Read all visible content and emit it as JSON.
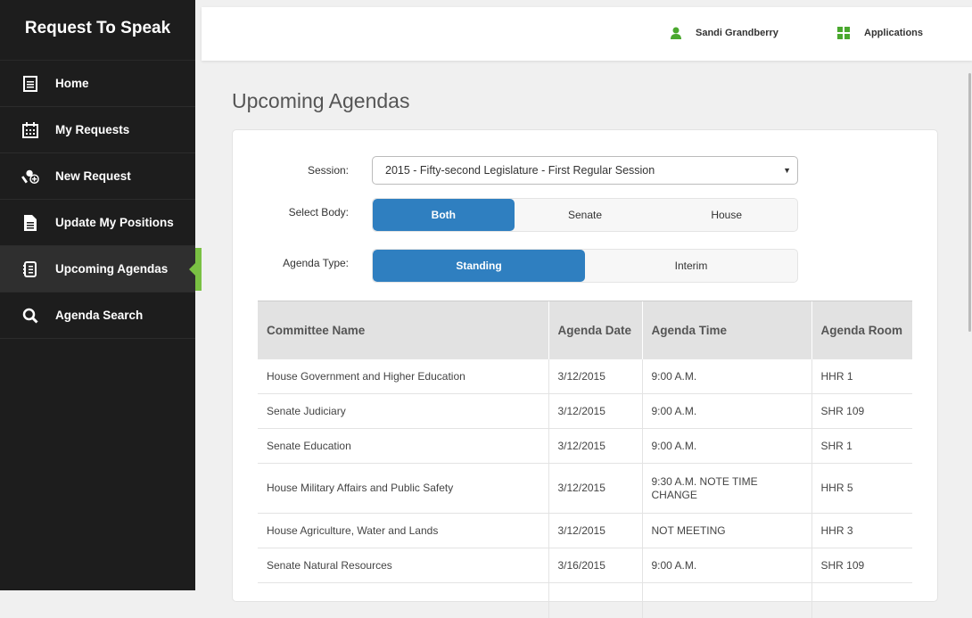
{
  "app": {
    "title": "Request To Speak"
  },
  "sidebar": {
    "items": [
      {
        "label": "Home",
        "icon": "home-list-icon"
      },
      {
        "label": "My Requests",
        "icon": "calendar-icon"
      },
      {
        "label": "New Request",
        "icon": "new-request-microphone-icon"
      },
      {
        "label": "Update My Positions",
        "icon": "document-icon"
      },
      {
        "label": "Upcoming Agendas",
        "icon": "agenda-icon"
      },
      {
        "label": "Agenda Search",
        "icon": "search-icon"
      }
    ],
    "active_index": 4
  },
  "header": {
    "user_name": "Sandi Grandberry",
    "apps_label": "Applications"
  },
  "page": {
    "title": "Upcoming Agendas"
  },
  "form": {
    "session_label": "Session:",
    "session_value": "2015 - Fifty-second Legislature - First Regular Session",
    "body_label": "Select Body:",
    "body_options": [
      "Both",
      "Senate",
      "House"
    ],
    "body_selected": "Both",
    "type_label": "Agenda Type:",
    "type_options": [
      "Standing",
      "Interim"
    ],
    "type_selected": "Standing"
  },
  "table": {
    "headers": [
      "Committee Name",
      "Agenda Date",
      "Agenda Time",
      "Agenda Room"
    ],
    "rows": [
      [
        "House Government and Higher Education",
        "3/12/2015",
        "9:00 A.M.",
        "HHR 1"
      ],
      [
        "Senate Judiciary",
        "3/12/2015",
        "9:00 A.M.",
        "SHR 109"
      ],
      [
        "Senate Education",
        "3/12/2015",
        "9:00 A.M.",
        "SHR 1"
      ],
      [
        "House Military Affairs and Public Safety",
        "3/12/2015",
        "9:30 A.M. NOTE TIME CHANGE",
        "HHR 5"
      ],
      [
        "House Agriculture, Water and Lands",
        "3/12/2015",
        "NOT MEETING",
        "HHR 3"
      ],
      [
        "Senate Natural Resources",
        "3/16/2015",
        "9:00 A.M.",
        "SHR 109"
      ],
      [
        "",
        "",
        "",
        ""
      ]
    ]
  },
  "colors": {
    "sidebar_bg": "#1d1d1d",
    "accent_green": "#7ac143",
    "selected_blue": "#2f7fc0"
  }
}
